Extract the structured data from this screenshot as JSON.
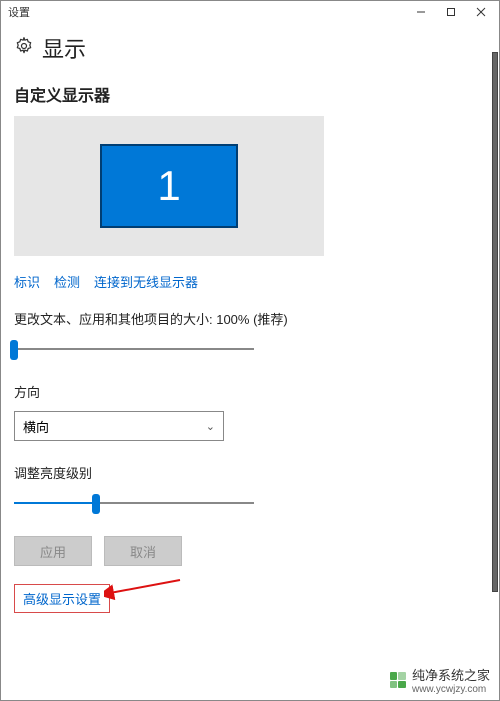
{
  "window": {
    "title": "设置"
  },
  "page": {
    "title": "显示",
    "sectionHeading": "自定义显示器"
  },
  "display": {
    "monitorNumber": "1"
  },
  "links": {
    "identify": "标识",
    "detect": "检测",
    "connectWireless": "连接到无线显示器"
  },
  "scale": {
    "label": "更改文本、应用和其他项目的大小: 100% (推荐)",
    "sliderPercent": 0
  },
  "orientation": {
    "label": "方向",
    "value": "横向"
  },
  "brightness": {
    "label": "调整亮度级别",
    "sliderPercent": 34
  },
  "buttons": {
    "apply": "应用",
    "cancel": "取消"
  },
  "advanced": {
    "label": "高级显示设置"
  },
  "watermark": {
    "text": "纯净系统之家",
    "url": "www.ycwjzy.com"
  }
}
